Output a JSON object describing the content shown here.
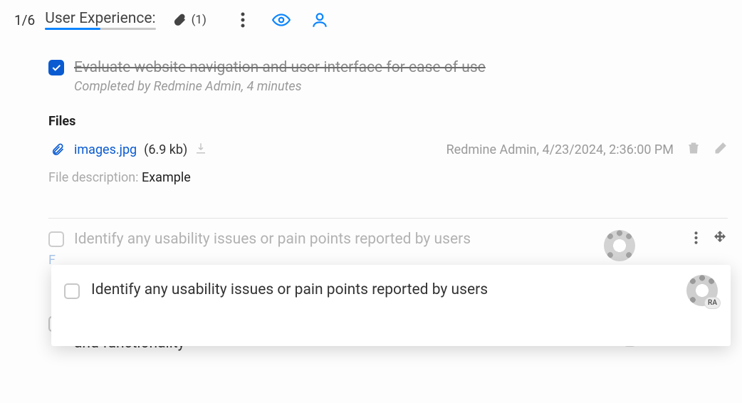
{
  "header": {
    "counter": "1/6",
    "title": "User Experience:",
    "attachment_count": "(1)"
  },
  "items": {
    "done": {
      "title": "Evaluate website navigation and user interface for ease of use",
      "meta": "Completed by Redmine Admin, 4 minutes"
    },
    "files": {
      "heading": "Files",
      "file": {
        "name": "images.jpg",
        "size": "(6.9 kb)",
        "meta": "Redmine Admin, 4/23/2024, 2:36:00 PM"
      },
      "desc_label": "File description: ",
      "desc_value": "Example"
    },
    "ghost": {
      "title": "Identify any usability issues or pain points reported by users",
      "files_hint_fragment": "F"
    },
    "dragged": {
      "title": "Identify any usability issues or pain points reported by users"
    },
    "third": {
      "title": "Conduct usability testing to gather feedback on website navigation and functionality"
    }
  },
  "avatar_initials": "RA"
}
